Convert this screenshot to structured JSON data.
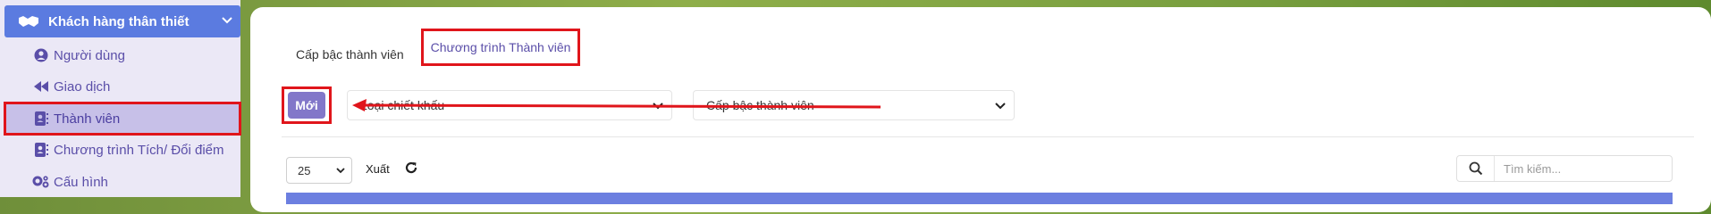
{
  "sidebar": {
    "header": {
      "label": "Khách hàng thân thiết",
      "icon": "handshake-icon"
    },
    "items": [
      {
        "label": "Người dùng",
        "icon": "user-circle-icon"
      },
      {
        "label": "Giao dịch",
        "icon": "rewind-icon"
      },
      {
        "label": "Thành viên",
        "icon": "contact-book-icon",
        "active": true
      },
      {
        "label": "Chương trình Tích/ Đổi điểm",
        "icon": "contact-book-icon"
      },
      {
        "label": "Cấu hình",
        "icon": "gears-icon"
      }
    ]
  },
  "main": {
    "tabs": [
      {
        "label": "Cấp bậc thành viên"
      },
      {
        "label": "Chương trình Thành viên",
        "active": true
      }
    ],
    "new_button": "Mới",
    "filters": {
      "discount_type": "Loại chiết khấu",
      "member_tier": "Cấp bậc thành viên"
    },
    "page_size": "25",
    "export_label": "Xuất",
    "search": {
      "placeholder": "Tìm kiếm..."
    }
  },
  "colors": {
    "accent": "#5b7be0",
    "primary_button": "#8277c9",
    "annotation_red": "#e0151b",
    "sidebar_bg": "#ebe8f6"
  }
}
